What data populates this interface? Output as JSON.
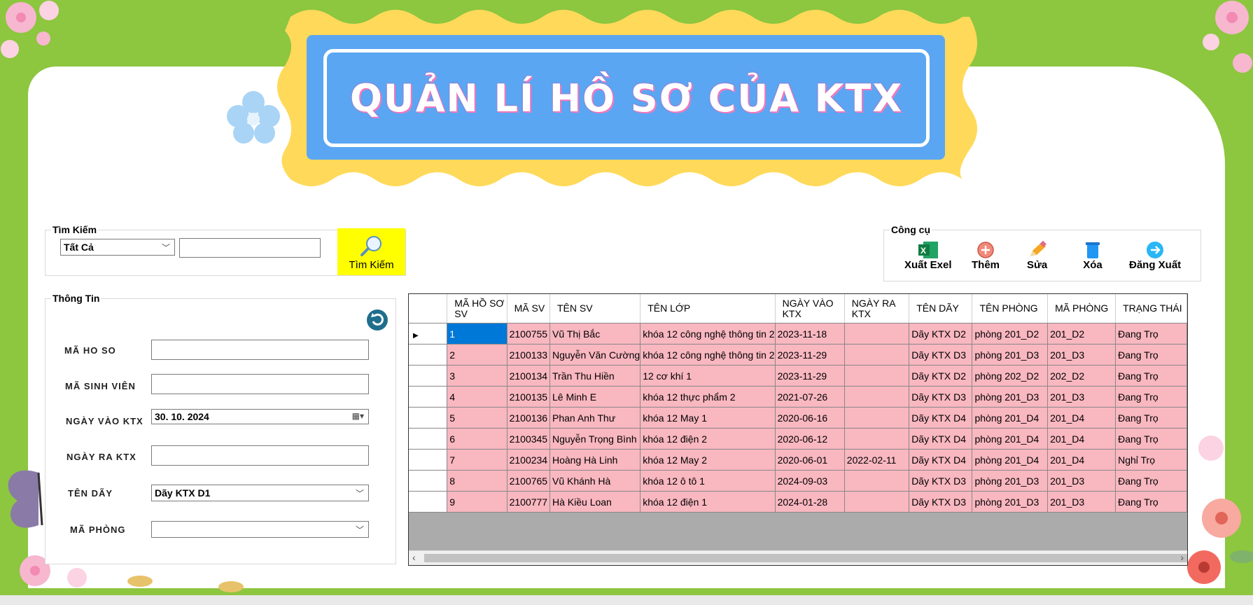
{
  "title": "QUẢN LÍ HỒ SƠ CỦA KTX",
  "search": {
    "legend": "Tìm Kiếm",
    "filter_value": "Tất Cả",
    "query_value": "",
    "button_label": "Tìm Kiếm"
  },
  "tools": {
    "legend": "Công cụ",
    "items": [
      {
        "label": "Xuất Exel",
        "icon": "excel-icon"
      },
      {
        "label": "Thêm",
        "icon": "add-icon"
      },
      {
        "label": "Sửa",
        "icon": "pencil-icon"
      },
      {
        "label": "Xóa",
        "icon": "trash-icon"
      },
      {
        "label": "Đăng Xuất",
        "icon": "logout-icon"
      }
    ]
  },
  "info": {
    "legend": "Thông Tin",
    "labels": {
      "ma_ho_so": "MÃ HO SO",
      "ma_sinh_vien": "MÃ SINH VIÊN",
      "ngay_vao": "NGÀY VÀO KTX",
      "ngay_ra": "NGÀY RA KTX",
      "ten_day": "TÊN DÃY",
      "ma_phong": "MÃ PHÒNG"
    },
    "values": {
      "ma_ho_so": "",
      "ma_sinh_vien": "",
      "ngay_vao": "30. 10. 2024",
      "ngay_ra": "",
      "ten_day": "Dãy KTX D1",
      "ma_phong": ""
    }
  },
  "table": {
    "headers": [
      "MÃ HỒ SƠ SV",
      "MÃ SV",
      "TÊN SV",
      "TÊN LỚP",
      "NGÀY VÀO KTX",
      "NGÀY RA KTX",
      "TÊN DÃY",
      "TÊN PHÒNG",
      "MÃ PHÒNG",
      "TRẠNG THÁI"
    ],
    "rows": [
      [
        "1",
        "2100755",
        "Vũ Thị Bắc",
        "khóa 12 công nghệ thông tin 2",
        "2023-11-18",
        "",
        "Dãy KTX D2",
        "phòng 201_D2",
        "201_D2",
        "Đang Trọ"
      ],
      [
        "2",
        "2100133",
        "Nguyễn Văn Cường",
        "khóa 12 công nghệ thông tin 2",
        "2023-11-29",
        "",
        "Dãy KTX D3",
        "phòng 201_D3",
        "201_D3",
        "Đang Trọ"
      ],
      [
        "3",
        "2100134",
        "Trần Thu Hiền",
        "12 cơ khí 1",
        "2023-11-29",
        "",
        "Dãy KTX D2",
        "phòng 202_D2",
        "202_D2",
        "Đang Trọ"
      ],
      [
        "4",
        "2100135",
        "Lê Minh E",
        "khóa 12 thực phẩm 2",
        "2021-07-26",
        "",
        "Dãy KTX D3",
        "phòng 201_D3",
        "201_D3",
        "Đang Trọ"
      ],
      [
        "5",
        "2100136",
        "Phan Anh Thư",
        "khóa 12 May 1",
        "2020-06-16",
        "",
        "Dãy KTX D4",
        "phòng 201_D4",
        "201_D4",
        "Đang Trọ"
      ],
      [
        "6",
        "2100345",
        "Nguyễn Trọng Bình",
        "khóa 12 điện 2",
        "2020-06-12",
        "",
        "Dãy KTX D4",
        "phòng 201_D4",
        "201_D4",
        "Đang Trọ"
      ],
      [
        "7",
        "2100234",
        "Hoàng Hà Linh",
        "khóa 12 May 2",
        "2020-06-01",
        "2022-02-11",
        "Dãy KTX D4",
        "phòng 201_D4",
        "201_D4",
        "Nghỉ Trọ"
      ],
      [
        "8",
        "2100765",
        "Vũ Khánh Hà",
        "khóa 12 ô tô 1",
        "2024-09-03",
        "",
        "Dãy KTX D3",
        "phòng 201_D3",
        "201_D3",
        "Đang Trọ"
      ],
      [
        "9",
        "2100777",
        "Hà Kiều Loan",
        "khóa 12 điện 1",
        "2024-01-28",
        "",
        "Dãy KTX D3",
        "phòng 201_D3",
        "201_D3",
        "Đang Trọ"
      ]
    ]
  },
  "colors": {
    "frame_green": "#8dc63f",
    "title_blue": "#5aa6f2",
    "wavy_yellow": "#ffd95a",
    "row_pink": "#f9b7c0",
    "selected_blue": "#0078d7",
    "search_yellow": "#ffff00"
  }
}
